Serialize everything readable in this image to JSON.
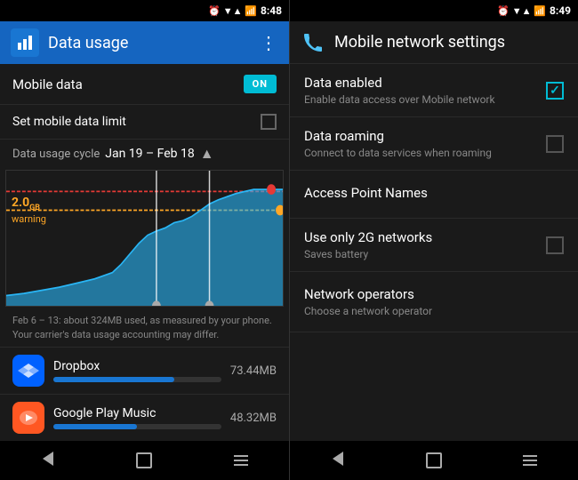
{
  "left": {
    "status": {
      "time": "8:48",
      "icons": "▼▲ 📶 🔋"
    },
    "header": {
      "title": "Data usage",
      "menu_icon": "⋮"
    },
    "mobile_data": {
      "label": "Mobile data",
      "toggle": "ON"
    },
    "data_limit": {
      "label": "Set mobile data limit"
    },
    "cycle": {
      "label": "Data usage cycle",
      "dates": "Jan 19 – Feb 18"
    },
    "warning": {
      "amount": "2.0",
      "unit": "GB",
      "label": "warning"
    },
    "chart_note": "Feb 6 – 13: about 324MB used, as measured by your phone. Your carrier's data usage accounting may differ.",
    "apps": [
      {
        "name": "Dropbox",
        "size": "73.44MB",
        "bar_pct": 72,
        "icon_color": "#0061FF",
        "icon_char": "📦"
      },
      {
        "name": "Google Play Music",
        "size": "48.32MB",
        "bar_pct": 50,
        "icon_color": "#FF5722",
        "icon_char": "🎵"
      }
    ]
  },
  "right": {
    "status": {
      "time": "8:49",
      "icons": "▼▲ 📶 🔋"
    },
    "header": {
      "title": "Mobile network settings"
    },
    "settings": [
      {
        "id": "data-enabled",
        "title": "Data enabled",
        "subtitle": "Enable data access over Mobile network",
        "type": "checkbox",
        "checked": true
      },
      {
        "id": "data-roaming",
        "title": "Data roaming",
        "subtitle": "Connect to data services when roaming",
        "type": "checkbox",
        "checked": false
      },
      {
        "id": "access-point",
        "title": "Access Point Names",
        "subtitle": "",
        "type": "plain"
      },
      {
        "id": "only-2g",
        "title": "Use only 2G networks",
        "subtitle": "Saves battery",
        "type": "checkbox",
        "checked": false
      },
      {
        "id": "network-operators",
        "title": "Network operators",
        "subtitle": "Choose a network operator",
        "type": "plain"
      }
    ]
  },
  "nav": {
    "back_label": "←",
    "home_label": "⌂",
    "recent_label": "▣"
  }
}
